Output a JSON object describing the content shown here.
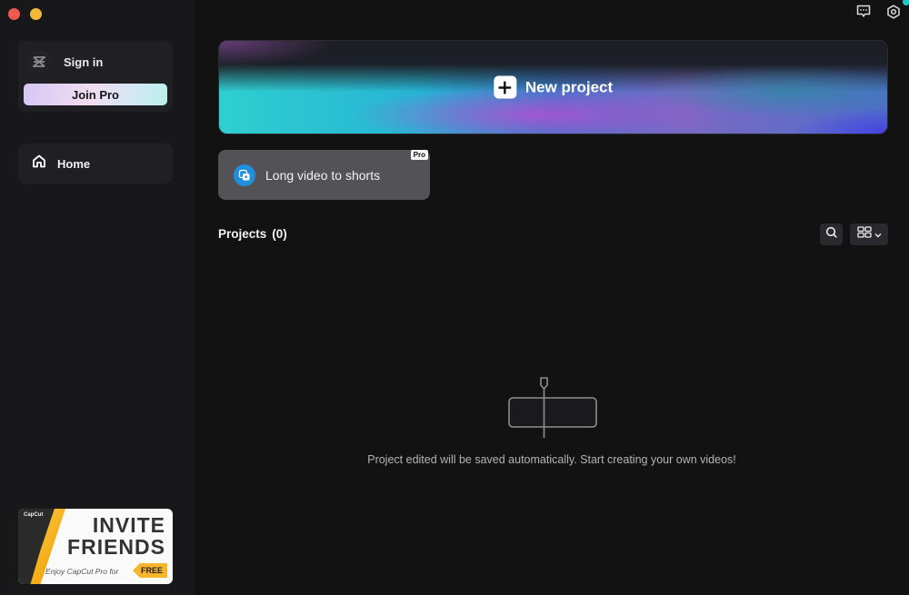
{
  "window": {
    "controls": [
      "close",
      "minimize"
    ]
  },
  "sidebar": {
    "account": {
      "logo_icon": "capcut-logo-icon",
      "sign_in_label": "Sign in",
      "join_pro_label": "Join Pro"
    },
    "nav": [
      {
        "icon": "home-icon",
        "label": "Home",
        "active": true
      }
    ],
    "invite_banner": {
      "brand": "CapCut",
      "title_line1": "INVITE",
      "title_line2": "FRIENDS",
      "subtitle": "Enjoy CapCut Pro for",
      "tag": "FREE"
    }
  },
  "topbar": {
    "icons": [
      "feedback-icon",
      "settings-icon"
    ],
    "notification_color": "#21c7c7"
  },
  "main": {
    "new_project": {
      "icon": "plus-icon",
      "label": "New project"
    },
    "features": [
      {
        "icon": "long-video-icon",
        "label": "Long video to shorts",
        "badge": "Pro"
      }
    ],
    "projects": {
      "title": "Projects",
      "count": "(0)",
      "search_icon": "search-icon",
      "view_icon": "grid-view-icon"
    },
    "empty_state": {
      "message": "Project edited will be saved automatically. Start creating your own videos!"
    }
  }
}
